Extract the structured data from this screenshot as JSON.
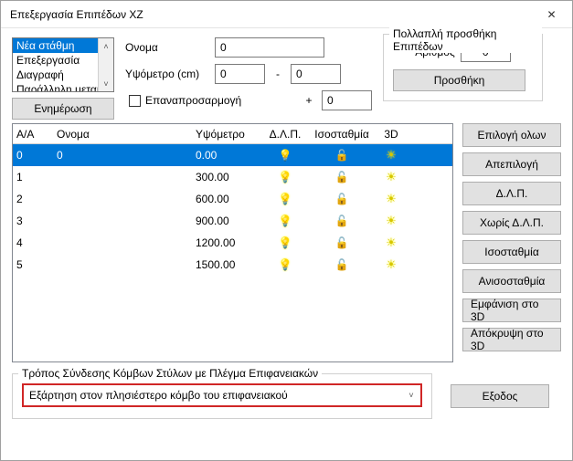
{
  "title": "Επεξεργασία Επιπέδων ΧZ",
  "listbox": {
    "items": [
      "Νέα στάθμη",
      "Επεξεργασία",
      "Διαγραφή",
      "Παράλληλη μετακ"
    ],
    "selected": 0
  },
  "labels": {
    "name": "Ονομα",
    "heightometer": "Υψόμετρο (cm)",
    "dash": "-",
    "plus": "+",
    "readjust": "Επαναπροσαρμογή",
    "update": "Ενημέρωση"
  },
  "values": {
    "name": "0",
    "ypo1": "0",
    "ypo2": "0",
    "ypo3": "0"
  },
  "multi": {
    "legend": "Πολλαπλή προσθήκη Επιπέδων",
    "count_label": "Αριθμός",
    "count": "0",
    "add": "Προσθήκη"
  },
  "table": {
    "headers": {
      "aa": "Α/Α",
      "name": "Ονομα",
      "ypo": "Υψόμετρο",
      "dlp": "Δ.Λ.Π.",
      "iso": "Ισοσταθμία",
      "td": "3D"
    },
    "rows": [
      {
        "aa": "0",
        "name": "0",
        "ypo": "0.00",
        "dlp": "off",
        "selected": true
      },
      {
        "aa": "1",
        "name": "",
        "ypo": "300.00",
        "dlp": "on",
        "selected": false
      },
      {
        "aa": "2",
        "name": "",
        "ypo": "600.00",
        "dlp": "on",
        "selected": false
      },
      {
        "aa": "3",
        "name": "",
        "ypo": "900.00",
        "dlp": "on",
        "selected": false
      },
      {
        "aa": "4",
        "name": "",
        "ypo": "1200.00",
        "dlp": "on",
        "selected": false
      },
      {
        "aa": "5",
        "name": "",
        "ypo": "1500.00",
        "dlp": "on",
        "selected": false
      }
    ]
  },
  "side": {
    "select_all": "Επιλογή ολων",
    "deselect": "Απεπιλογή",
    "dlp": "Δ.Λ.Π.",
    "no_dlp": "Χωρίς Δ.Λ.Π.",
    "iso": "Ισοσταθμία",
    "noiso": "Ανισοσταθμία",
    "show3d": "Εμφάνιση στο 3D",
    "hide3d": "Απόκρυψη στο 3D"
  },
  "bottom": {
    "legend": "Τρόπος Σύνδεσης Κόμβων Στύλων με Πλέγμα Επιφανειακών",
    "combo": "Εξάρτηση στον πλησιέστερο κόμβο του επιφανειακού",
    "exit": "Εξοδος"
  }
}
